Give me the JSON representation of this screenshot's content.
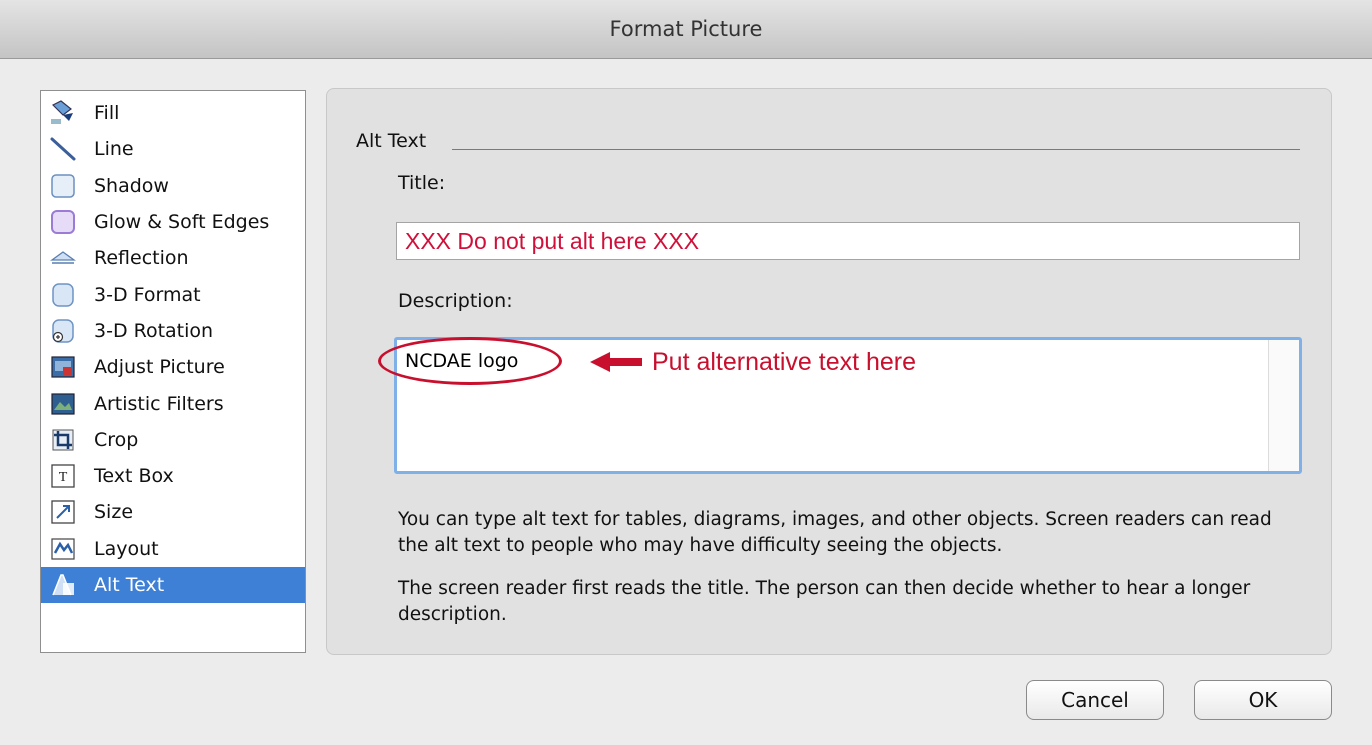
{
  "window": {
    "title": "Format Picture"
  },
  "sidebar": {
    "items": [
      {
        "label": "Fill",
        "icon": "fill-bucket-icon"
      },
      {
        "label": "Line",
        "icon": "line-icon"
      },
      {
        "label": "Shadow",
        "icon": "shadow-icon"
      },
      {
        "label": "Glow & Soft Edges",
        "icon": "glow-icon"
      },
      {
        "label": "Reflection",
        "icon": "reflection-icon"
      },
      {
        "label": "3-D Format",
        "icon": "3d-format-icon"
      },
      {
        "label": "3-D Rotation",
        "icon": "3d-rotation-icon"
      },
      {
        "label": "Adjust Picture",
        "icon": "adjust-picture-icon"
      },
      {
        "label": "Artistic Filters",
        "icon": "artistic-filters-icon"
      },
      {
        "label": "Crop",
        "icon": "crop-icon"
      },
      {
        "label": "Text Box",
        "icon": "text-box-icon"
      },
      {
        "label": "Size",
        "icon": "size-icon"
      },
      {
        "label": "Layout",
        "icon": "layout-icon"
      },
      {
        "label": "Alt Text",
        "icon": "alt-text-icon",
        "selected": true
      }
    ]
  },
  "panel": {
    "section_label": "Alt Text",
    "title_label": "Title:",
    "title_value": "XXX Do not put alt here XXX",
    "description_label": "Description:",
    "description_value": "NCDAE logo",
    "annotation": "Put alternative text here",
    "help_text_1": "You can type alt text for tables, diagrams, images, and other objects. Screen readers can read the alt text to people who may have difficulty seeing the objects.",
    "help_text_2": "The screen reader first reads the title. The person can then decide whether to hear a longer description."
  },
  "buttons": {
    "cancel": "Cancel",
    "ok": "OK"
  },
  "colors": {
    "selected": "#3d80d6",
    "annotation": "#c8102e",
    "focus_ring": "#7fb0e8"
  }
}
